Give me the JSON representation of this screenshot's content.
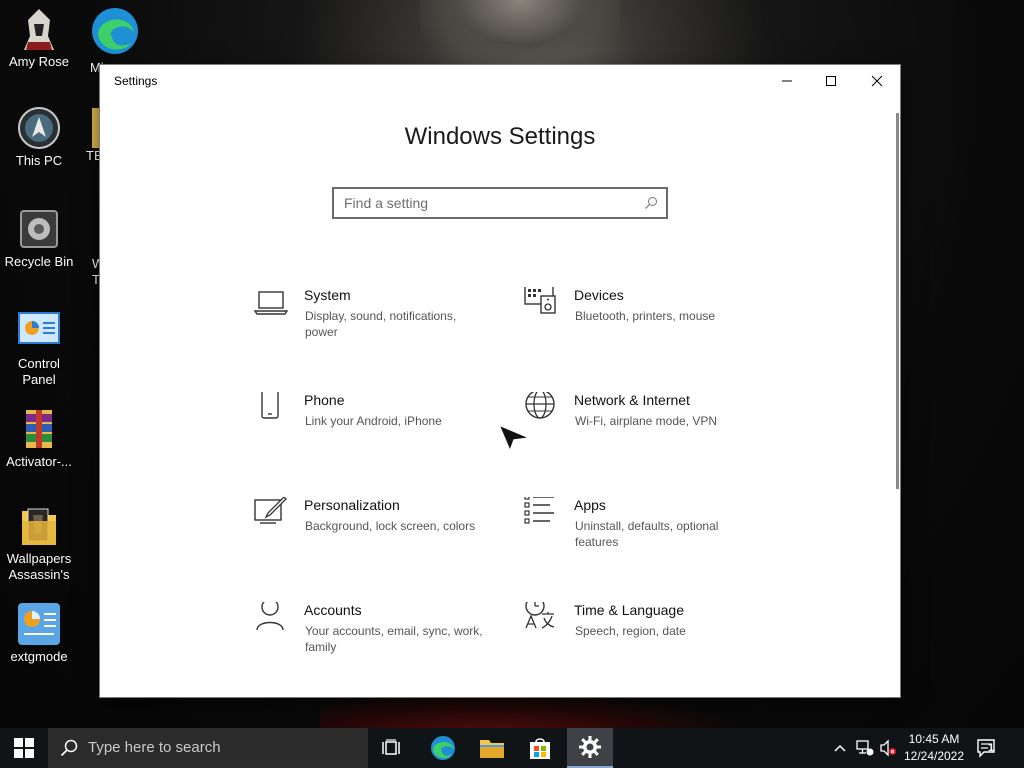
{
  "desktop": {
    "icons": [
      {
        "label": "Amy Rose"
      },
      {
        "label": "This PC"
      },
      {
        "label": "Recycle Bin"
      },
      {
        "label": "Control Panel"
      },
      {
        "label": "Activator-..."
      },
      {
        "label": "Wallpapers Assassin's"
      },
      {
        "label": "extgmode"
      }
    ],
    "partial": {
      "edge_label": "Mi",
      "te_label": "TE",
      "w_label": "W",
      "t_label": "T"
    }
  },
  "window": {
    "title": "Settings",
    "heading": "Windows Settings",
    "search": {
      "placeholder": "Find a setting"
    },
    "tiles": [
      {
        "name": "System",
        "desc": "Display, sound, notifications, power",
        "icon": "laptop-icon"
      },
      {
        "name": "Devices",
        "desc": "Bluetooth, printers, mouse",
        "icon": "devices-icon"
      },
      {
        "name": "Phone",
        "desc": "Link your Android, iPhone",
        "icon": "phone-icon"
      },
      {
        "name": "Network & Internet",
        "desc": "Wi-Fi, airplane mode, VPN",
        "icon": "globe-icon"
      },
      {
        "name": "Personalization",
        "desc": "Background, lock screen, colors",
        "icon": "paintbrush-icon"
      },
      {
        "name": "Apps",
        "desc": "Uninstall, defaults, optional features",
        "icon": "apps-list-icon"
      },
      {
        "name": "Accounts",
        "desc": "Your accounts, email, sync, work, family",
        "icon": "person-icon"
      },
      {
        "name": "Time & Language",
        "desc": "Speech, region, date",
        "icon": "time-language-icon"
      }
    ]
  },
  "taskbar": {
    "search_placeholder": "Type here to search",
    "time": "10:45 AM",
    "date": "12/24/2022",
    "notification_count": "1"
  }
}
